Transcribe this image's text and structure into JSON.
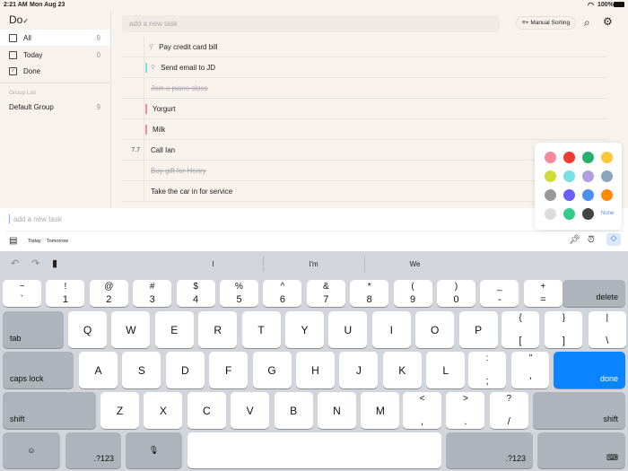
{
  "status": {
    "time": "2:21 AM",
    "date": "Mon Aug 23",
    "battery": "100%"
  },
  "app": {
    "title": "Do"
  },
  "sidebar": {
    "items": [
      {
        "label": "All",
        "count": "9",
        "icon": "inbox-icon"
      },
      {
        "label": "Today",
        "count": "0",
        "icon": "calendar-icon"
      },
      {
        "label": "Done",
        "count": "",
        "icon": "checkbox-icon"
      }
    ],
    "group_header": "Group List",
    "groups": [
      {
        "label": "Default Group",
        "count": "9"
      }
    ]
  },
  "header": {
    "add_placeholder": "add a new task",
    "sort_label": "Manual Sorting"
  },
  "tasks": [
    {
      "num": "",
      "text": "Pay credit card bill",
      "pinned": true,
      "done": false,
      "color": ""
    },
    {
      "num": "",
      "text": "Send email to JD",
      "pinned": true,
      "done": false,
      "color": "#7adfe6"
    },
    {
      "num": "",
      "text": "Join a piano class",
      "pinned": false,
      "done": true,
      "color": ""
    },
    {
      "num": "",
      "text": "Yorgurt",
      "pinned": false,
      "done": false,
      "color": "#f28aa0"
    },
    {
      "num": "",
      "text": "Milk",
      "pinned": false,
      "done": false,
      "color": "#f28aa0"
    },
    {
      "num": "7.7",
      "text": "Call Ian",
      "pinned": false,
      "done": false,
      "color": ""
    },
    {
      "num": "",
      "text": "Buy gift for Henry",
      "pinned": false,
      "done": true,
      "color": ""
    },
    {
      "num": "",
      "text": "Take the car in for service",
      "pinned": false,
      "done": false,
      "color": ""
    }
  ],
  "compose": {
    "placeholder": "add a new task",
    "today": "Today",
    "tomorrow": "Tomorrow"
  },
  "palette": {
    "colors": [
      "#f58a9e",
      "#ef3b30",
      "#26b06e",
      "#fdc737",
      "#cfdc38",
      "#7adfe6",
      "#b29ddf",
      "#8aa6bd",
      "#9a9a9a",
      "#6e5ef7",
      "#4a8ff0",
      "#fd8a07",
      "#dcdcdc",
      "#34cc8a",
      "#434343"
    ],
    "none_label": "None"
  },
  "suggestions": [
    "I",
    "I'm",
    "We"
  ],
  "keyboard": {
    "row1": [
      [
        "~",
        "`"
      ],
      [
        "!",
        "1"
      ],
      [
        "@",
        "2"
      ],
      [
        "#",
        "3"
      ],
      [
        "$",
        "4"
      ],
      [
        "%",
        "5"
      ],
      [
        "^",
        "6"
      ],
      [
        "&",
        "7"
      ],
      [
        "*",
        "8"
      ],
      [
        "(",
        "9"
      ],
      [
        ")",
        "0"
      ],
      [
        "_",
        "-"
      ],
      [
        "+",
        "="
      ]
    ],
    "delete": "delete",
    "tab": "tab",
    "row2": [
      "Q",
      "W",
      "E",
      "R",
      "T",
      "Y",
      "U",
      "I",
      "O",
      "P"
    ],
    "row2sym": [
      [
        "{",
        "["
      ],
      [
        "}",
        "]"
      ],
      [
        "|",
        "\\"
      ]
    ],
    "caps": "caps lock",
    "row3": [
      "A",
      "S",
      "D",
      "F",
      "G",
      "H",
      "J",
      "K",
      "L"
    ],
    "row3sym": [
      [
        ":",
        ";"
      ],
      [
        "\"",
        "'"
      ]
    ],
    "done": "done",
    "shift": "shift",
    "row4": [
      "Z",
      "X",
      "C",
      "V",
      "B",
      "N",
      "M"
    ],
    "row4sym": [
      [
        "<",
        ","
      ],
      [
        ">",
        "."
      ],
      [
        "?",
        "/"
      ]
    ],
    "numkey": ".?123"
  }
}
